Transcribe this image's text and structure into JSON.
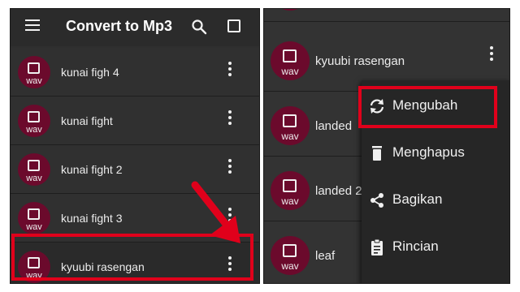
{
  "colors": {
    "accent_red": "#e0001b",
    "badge": "#6b0a2c",
    "panel": "#2f2f2f"
  },
  "left_screen": {
    "appbar": {
      "title": "Convert to Mp3",
      "menu_icon": "hamburger-icon",
      "search_icon": "search-icon",
      "select_icon": "square-icon"
    },
    "items": [
      {
        "name": "kunai figh 4",
        "ext": "wav"
      },
      {
        "name": "kunai fight",
        "ext": "wav"
      },
      {
        "name": "kunai fight 2",
        "ext": "wav"
      },
      {
        "name": "kunai fight 3",
        "ext": "wav"
      },
      {
        "name": "kyuubi rasengan",
        "ext": "wav"
      }
    ]
  },
  "right_screen": {
    "items": [
      {
        "name": "kyuubi rasengan",
        "ext": "wav"
      },
      {
        "name": "landed",
        "ext": "wav"
      },
      {
        "name": "landed 2",
        "ext": "wav"
      },
      {
        "name": "leaf",
        "ext": "wav"
      }
    ],
    "context_menu": [
      {
        "label": "Mengubah",
        "icon": "sync-icon"
      },
      {
        "label": "Menghapus",
        "icon": "trash-icon"
      },
      {
        "label": "Bagikan",
        "icon": "share-icon"
      },
      {
        "label": "Rincian",
        "icon": "clipboard-icon"
      }
    ]
  }
}
